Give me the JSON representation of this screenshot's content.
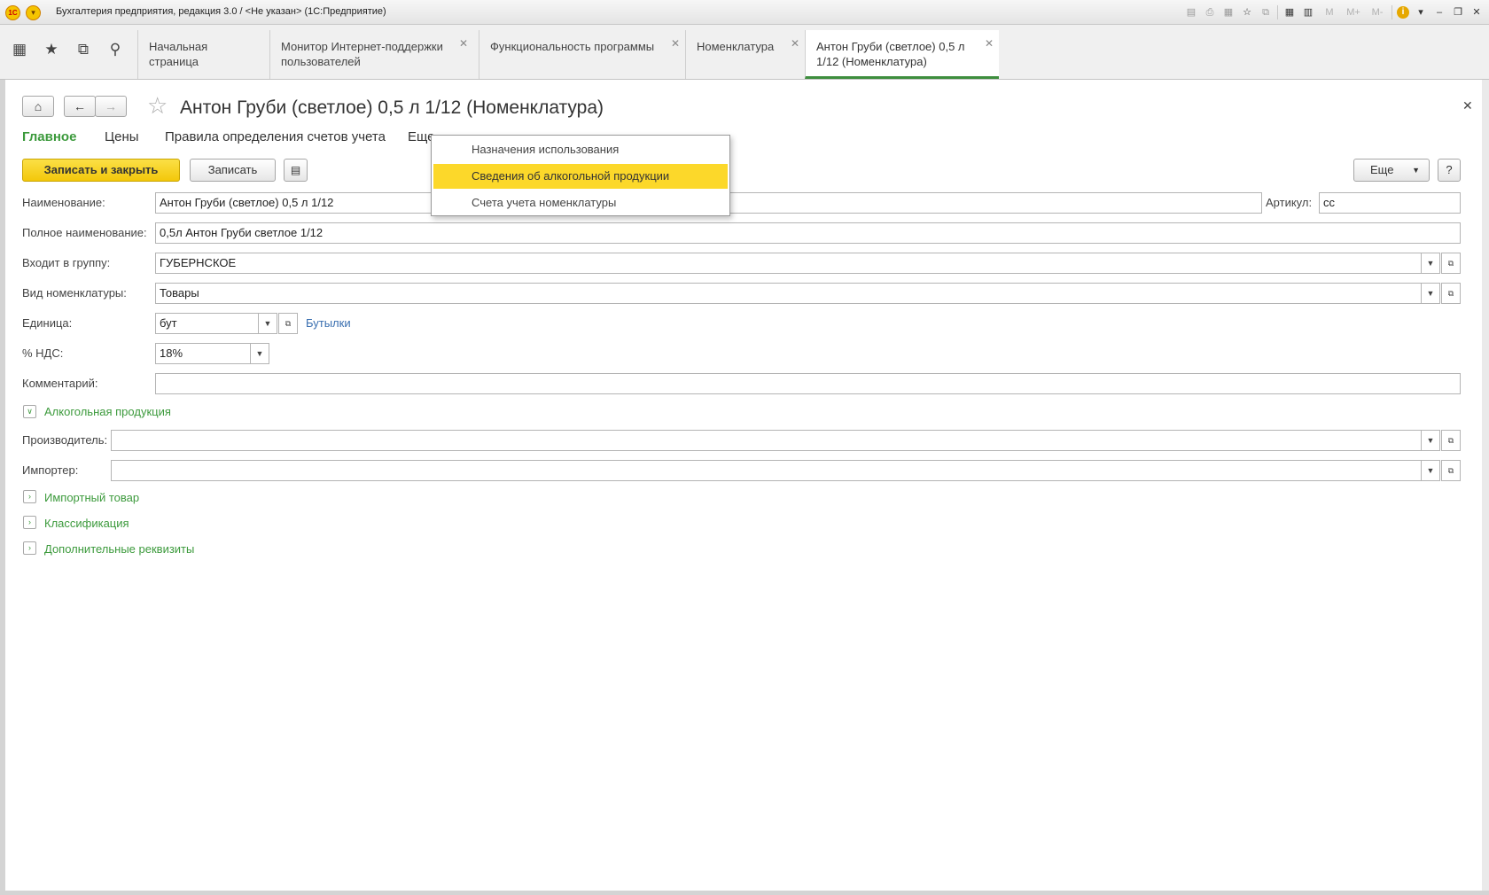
{
  "window": {
    "title": "Бухгалтерия предприятия, редакция 3.0 / <Не указан>  (1С:Предприятие)",
    "m_labels": [
      "M",
      "M+",
      "M-"
    ]
  },
  "tabs": [
    {
      "label": "Начальная страница",
      "closable": false
    },
    {
      "label": "Монитор Интернет-поддержки пользователей",
      "closable": true
    },
    {
      "label": "Функциональность программы",
      "closable": true
    },
    {
      "label": "Номенклатура",
      "closable": true
    },
    {
      "label": "Антон Груби (светлое) 0,5 л 1/12 (Номенклатура)",
      "closable": true,
      "active": true
    }
  ],
  "form": {
    "title": "Антон Груби (светлое) 0,5 л 1/12 (Номенклатура)",
    "section_tabs": [
      "Главное",
      "Цены",
      "Правила определения счетов учета",
      "Еще"
    ],
    "buttons": {
      "save_close": "Записать и закрыть",
      "save": "Записать",
      "more": "Еще",
      "help": "?"
    },
    "fields": {
      "name_label": "Наименование:",
      "name_value": "Антон Груби (светлое) 0,5 л 1/12",
      "article_label": "Артикул:",
      "article_value": "сс",
      "fullname_label": "Полное наименование:",
      "fullname_value": "0,5л Антон Груби светлое  1/12",
      "group_label": "Входит в группу:",
      "group_value": "ГУБЕРНСКОЕ",
      "kind_label": "Вид номенклатуры:",
      "kind_value": "Товары",
      "unit_label": "Единица:",
      "unit_value": "бут",
      "unit_link": "Бутылки",
      "vat_label": "% НДС:",
      "vat_value": "18%",
      "comment_label": "Комментарий:",
      "comment_value": "",
      "producer_label": "Производитель:",
      "producer_value": "",
      "importer_label": "Импортер:",
      "importer_value": ""
    },
    "groups": {
      "alcohol": "Алкогольная продукция",
      "import": "Импортный товар",
      "classification": "Классификация",
      "extra": "Дополнительные реквизиты"
    }
  },
  "popup_menu": {
    "items": [
      {
        "label": "Назначения использования",
        "selected": false
      },
      {
        "label": "Сведения об алкогольной продукции",
        "selected": true
      },
      {
        "label": "Счета учета номенклатуры",
        "selected": false
      }
    ]
  },
  "colors": {
    "accent_green": "#3c9a3c",
    "primary_button": "#f3c80a",
    "menu_highlight": "#fcd82a",
    "link_blue": "#3a6fb0"
  }
}
